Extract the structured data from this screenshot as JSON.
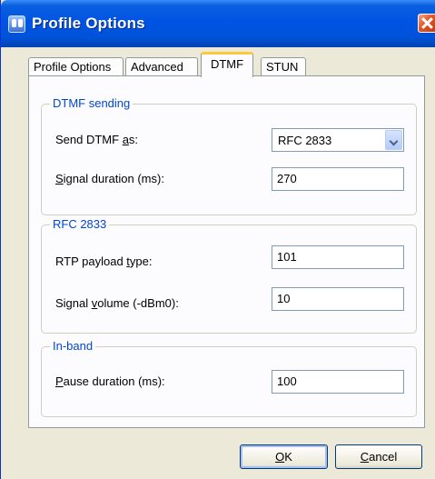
{
  "window": {
    "title": "Profile Options"
  },
  "tabs": [
    {
      "label": "Profile Options",
      "active": false
    },
    {
      "label": "Advanced",
      "active": false
    },
    {
      "label": "DTMF",
      "active": true
    },
    {
      "label": "STUN",
      "active": false
    }
  ],
  "dtmf_sending": {
    "title": "DTMF sending",
    "send_dtmf_as": {
      "label_pre": "Send DTMF ",
      "label_key": "a",
      "label_post": "s:",
      "value": "RFC 2833"
    },
    "signal_duration": {
      "label_pre": "",
      "label_key": "S",
      "label_post": "ignal duration (ms):",
      "value": "270"
    }
  },
  "rfc2833": {
    "title": "RFC 2833",
    "rtp_payload_type": {
      "label_pre": "RTP payload ",
      "label_key": "t",
      "label_post": "ype:",
      "value": "101"
    },
    "signal_volume": {
      "label_pre": "Signal ",
      "label_key": "v",
      "label_post": "olume (-dBm0):",
      "value": "10"
    }
  },
  "in_band": {
    "title": "In-band",
    "pause_duration": {
      "label_pre": "",
      "label_key": "P",
      "label_post": "ause duration (ms):",
      "value": "100"
    }
  },
  "buttons": {
    "ok": {
      "key": "O",
      "rest": "K"
    },
    "cancel": {
      "key": "C",
      "rest": "ancel"
    }
  },
  "colors": {
    "titlebar": "#0054e3",
    "group_title": "#0046d5",
    "active_tab_accent": "#ffc83c"
  }
}
